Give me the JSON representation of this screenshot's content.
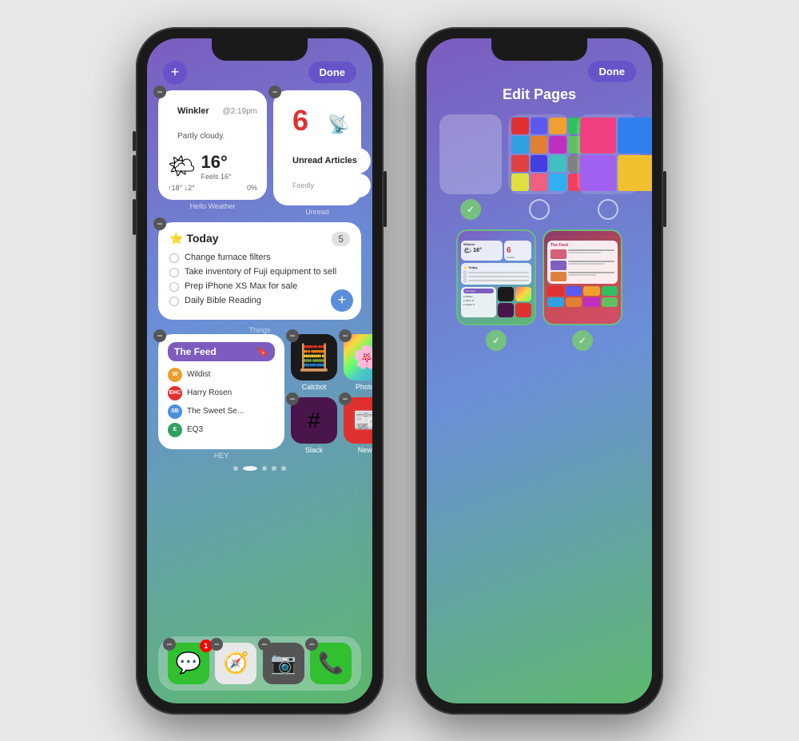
{
  "phone1": {
    "done_label": "Done",
    "plus_label": "+",
    "weather": {
      "location": "Winkler",
      "time": "@2:19pm",
      "description": "Partly cloudy.",
      "temperature": "16°",
      "feels_like": "Feels 16°",
      "high": "↑18°",
      "low": "↓2°",
      "precip": "0%",
      "widget_name": "Hello Weather"
    },
    "unread": {
      "count": "6",
      "title": "Unread Articles",
      "subtitle": "Feedly",
      "widget_name": "Unread"
    },
    "things": {
      "title": "Today",
      "count": "5",
      "todos": [
        "Change furnace filters",
        "Take inventory of Fuji equipment to sell",
        "Prep iPhone XS Max for sale",
        "Daily Bible Reading"
      ],
      "widget_name": "Things"
    },
    "feed": {
      "title": "The Feed",
      "items": [
        {
          "initial": "W",
          "color": "#e8a030",
          "name": "Wildist"
        },
        {
          "initial": "EHC",
          "color": "#e03030",
          "name": "Harry Rosen"
        },
        {
          "initial": "SB",
          "color": "#4a90d9",
          "name": "The Sweet Se..."
        },
        {
          "initial": "E",
          "color": "#30a060",
          "name": "EQ3"
        }
      ],
      "widget_name": "HEY"
    },
    "apps": [
      {
        "icon": "🧮",
        "label": "Calcbot",
        "bg": "#2a2a2a"
      },
      {
        "icon": "📷",
        "label": "Photos",
        "bg": "#f0a040"
      },
      {
        "icon": "💬",
        "label": "Slack",
        "bg": "#4a154b"
      },
      {
        "icon": "📰",
        "label": "News",
        "bg": "#e03030"
      }
    ],
    "dock": [
      {
        "icon": "💬",
        "label": "Messages",
        "bg": "#30c030",
        "badge": "1"
      },
      {
        "icon": "🧭",
        "label": "Safari",
        "bg": "#0080ff",
        "badge": null
      },
      {
        "icon": "📸",
        "label": "Camera",
        "bg": "#555",
        "badge": null
      },
      {
        "icon": "📞",
        "label": "Phone",
        "bg": "#30c030",
        "badge": null
      }
    ],
    "dots": 5,
    "active_dot": 2
  },
  "phone2": {
    "done_label": "Done",
    "title": "Edit Pages",
    "pages_top": [
      {
        "type": "blank",
        "checked": true
      },
      {
        "type": "appgrid",
        "checked": false
      },
      {
        "type": "appgrid2",
        "checked": false
      }
    ],
    "pages_bottom": [
      {
        "type": "screenshot1",
        "checked": true
      },
      {
        "type": "screenshot2",
        "checked": true
      }
    ]
  }
}
